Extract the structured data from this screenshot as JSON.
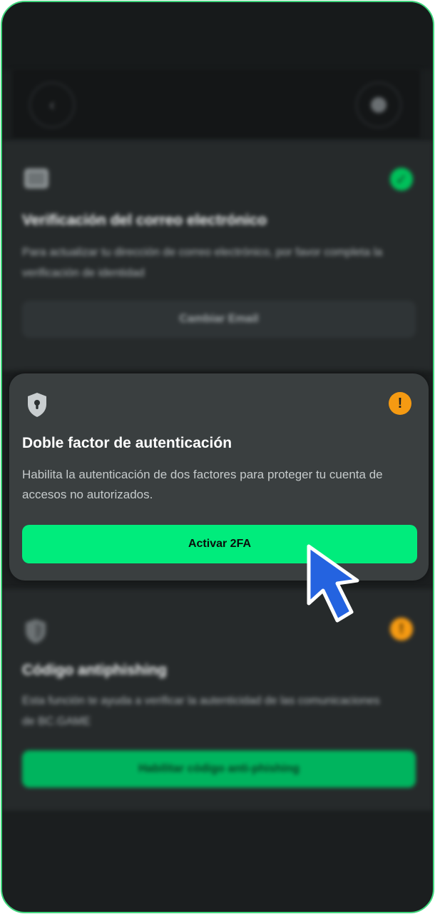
{
  "header": {
    "back_icon": "chevron-left-icon",
    "settings_icon": "gear-icon"
  },
  "email_card": {
    "icon": "envelope-icon",
    "status_icon": "check-icon",
    "status_color": "#00c05a",
    "title": "Verificación del correo electrónico",
    "description": "Para actualizar tu dirección de correo electrónico, por favor completa la verificación de identidad",
    "button_label": "Cambiar Email"
  },
  "twofa_card": {
    "icon": "shield-keyhole-icon",
    "status_icon": "exclamation-icon",
    "status_symbol": "!",
    "status_color": "#f59a12",
    "title": "Doble factor de autenticación",
    "description": "Habilita la autenticación de dos factores para proteger tu cuenta de accesos no autorizados.",
    "button_label": "Activar 2FA",
    "button_color": "#00ec7c"
  },
  "antiphishing_card": {
    "icon": "shield-icon",
    "status_icon": "exclamation-icon",
    "status_symbol": "!",
    "status_color": "#f59a12",
    "title": "Código antiphishing",
    "description": "Esta función te ayuda a verificar la autenticidad de las comunicaciones de BC.GAME",
    "button_label": "Habilitar código anti-phishing",
    "button_color": "#00b45e"
  },
  "pointer": {
    "icon": "mouse-pointer-icon",
    "color": "#2463e0"
  }
}
